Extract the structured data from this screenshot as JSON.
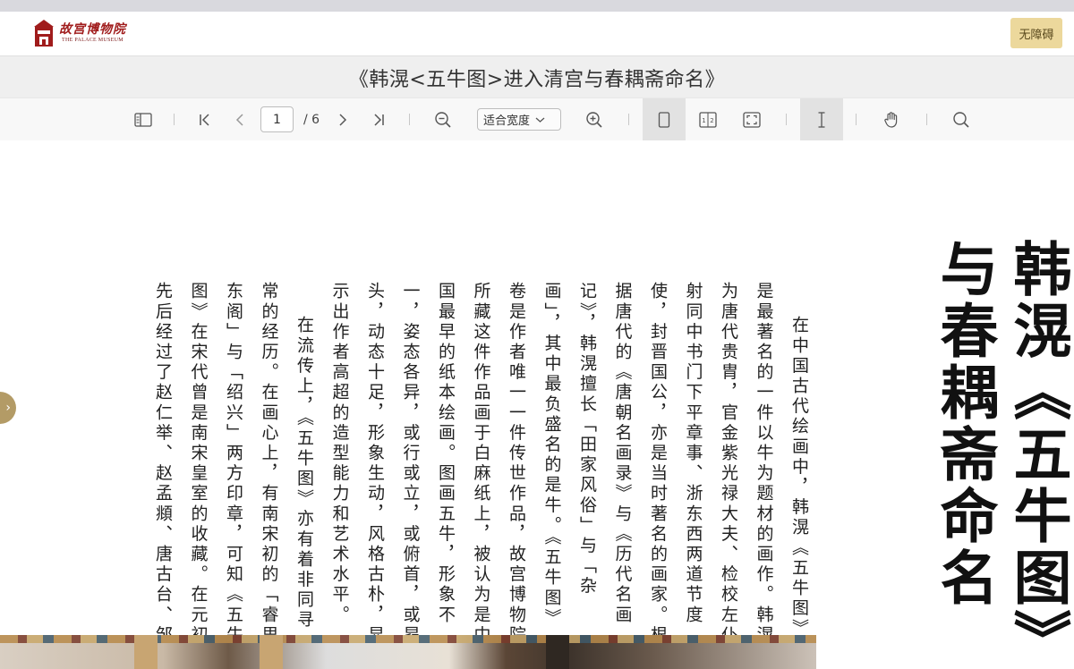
{
  "header": {
    "logo_cn": "故宫博物院",
    "logo_en": "THE PALACE MUSEUM",
    "accessibility_label": "无障碍"
  },
  "document": {
    "title": "《韩滉<五牛图>进入清宫与春耦斋命名》"
  },
  "toolbar": {
    "page_current": "1",
    "page_total": "/ 6",
    "zoom_label": "适合宽度",
    "icons": [
      "sidebar-toggle-icon",
      "first-page-icon",
      "prev-page-icon",
      "next-page-icon",
      "last-page-icon",
      "zoom-out-icon",
      "zoom-in-icon",
      "single-page-icon",
      "two-page-icon",
      "fullscreen-icon",
      "text-select-icon",
      "hand-tool-icon",
      "search-icon"
    ]
  },
  "article": {
    "title_line1": "韩滉《五牛图》",
    "title_line2": "与春耦斋命名",
    "paragraph1": "在中国古代绘画中，韩滉《五牛图》是最著名的一件以牛为题材的画作。韩滉为唐代贵胄，官金紫光禄大夫、检校左仆射同中书门下平章事、浙东西两道节度使，封晋国公，亦是当时著名的画家。根据唐代的《唐朝名画录》与《历代名画记》，韩滉擅长「田家风俗」与「杂画」，其中最负盛名的是牛。《五牛图》卷是作者唯一一件传世作品，故宫博物院所藏这件作品画于白麻纸上，被认为是中国最早的纸本绘画。图画五牛，形象不一，姿态各异，或行或立，或俯首，或昂头，动态十足，形象生动，风格古朴，显示出作者高超的造型能力和艺术水平。",
    "paragraph2": "在流传上，《五牛图》亦有着非同寻常的经历。在画心上，有南宋初的「睿思东阁」与「绍兴」两方印章，可知《五牛图》在宋代曾是南宋皇室的收藏。在元初先后经过了赵仁举、赵孟頫、唐古台、邹"
  },
  "colors": {
    "accent_gold": "#ecd89c",
    "logo_red": "#a01c1c",
    "handle_gold": "#b39b66"
  }
}
